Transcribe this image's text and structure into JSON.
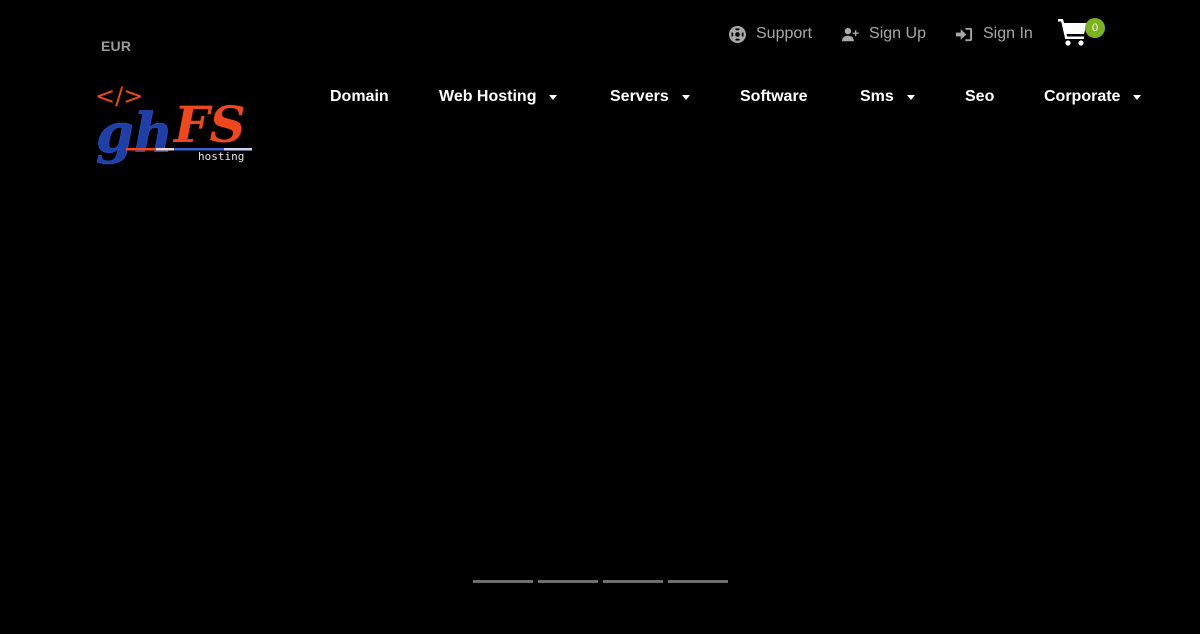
{
  "currency": {
    "label": "EUR"
  },
  "topbar": {
    "links": [
      {
        "label": "Support",
        "icon": "life-ring-icon"
      },
      {
        "label": "Sign Up",
        "icon": "user-plus-icon"
      },
      {
        "label": "Sign In",
        "icon": "sign-in-icon"
      }
    ],
    "cart": {
      "icon": "shopping-cart-icon",
      "count": "0"
    }
  },
  "logo": {
    "code_mark": "</>",
    "text_left": "gh",
    "text_right": "FS",
    "tagline": "hosting",
    "colors": {
      "blue": "#1f3fa8",
      "orange": "#f0471c"
    }
  },
  "nav": {
    "items": [
      {
        "label": "Domain",
        "has_dropdown": false
      },
      {
        "label": "Web Hosting",
        "has_dropdown": true
      },
      {
        "label": "Servers",
        "has_dropdown": true
      },
      {
        "label": "Software",
        "has_dropdown": false
      },
      {
        "label": "Sms",
        "has_dropdown": true
      },
      {
        "label": "Seo",
        "has_dropdown": false
      },
      {
        "label": "Corporate",
        "has_dropdown": true
      }
    ]
  },
  "slider": {
    "slide_count": 4,
    "indicators": [
      "Slide 1",
      "Slide 2",
      "Slide 3",
      "Slide 4"
    ]
  },
  "theme": {
    "background": "#000000",
    "nav_text": "#ffffff",
    "muted_text": "#a8a8a8",
    "badge": "#7bb31a",
    "indicator": "#6e6e6e"
  }
}
